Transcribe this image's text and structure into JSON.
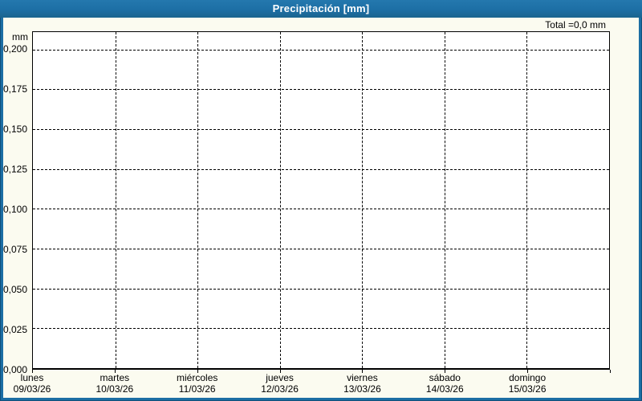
{
  "window": {
    "title": "Precipitación [mm]",
    "total_label": "Total =0,0 mm"
  },
  "colors": {
    "frame": "#1c6ea4",
    "frame_outline": "#11507c",
    "titlebar": "#1d6fa5",
    "title_text": "#ffffff",
    "background": "#fbfbf0",
    "plot_background": "#ffffff",
    "grid_line": "#000000",
    "text": "#000000"
  },
  "chart_data": {
    "type": "line",
    "title": "Precipitación [mm]",
    "ylabel": "mm",
    "total_label": "Total =0,0 mm",
    "x_categories": [
      {
        "day": "lunes",
        "date": "09/03/26"
      },
      {
        "day": "martes",
        "date": "10/03/26"
      },
      {
        "day": "miércoles",
        "date": "11/03/26"
      },
      {
        "day": "jueves",
        "date": "12/03/26"
      },
      {
        "day": "viernes",
        "date": "13/03/26"
      },
      {
        "day": "sábado",
        "date": "14/03/26"
      },
      {
        "day": "domingo",
        "date": "15/03/26"
      }
    ],
    "series": [
      {
        "name": "Precipitación",
        "values": [
          0,
          0,
          0,
          0,
          0,
          0,
          0
        ]
      }
    ],
    "y_ticks": [
      {
        "value": 0.0,
        "label": "0,000"
      },
      {
        "value": 0.025,
        "label": "0,025"
      },
      {
        "value": 0.05,
        "label": "0,050"
      },
      {
        "value": 0.075,
        "label": "0,075"
      },
      {
        "value": 0.1,
        "label": "0,100"
      },
      {
        "value": 0.125,
        "label": "0,125"
      },
      {
        "value": 0.15,
        "label": "0,150"
      },
      {
        "value": 0.175,
        "label": "0,175"
      },
      {
        "value": 0.2,
        "label": "0,200"
      }
    ],
    "ylim": [
      0,
      0.211
    ],
    "grid": "dashed, horizontal and vertical (one vertical line per day)",
    "legend": "none"
  }
}
